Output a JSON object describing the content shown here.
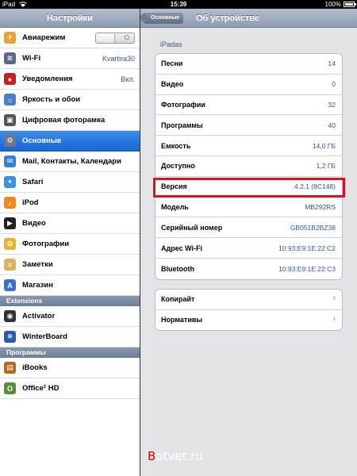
{
  "status": {
    "device": "iPad",
    "time": "15:39",
    "battery": "100%"
  },
  "sidebar": {
    "title": "Настройки",
    "items": [
      {
        "label": "Авиарежим",
        "icon": "airplane-icon",
        "toggle": "O"
      },
      {
        "label": "Wi-Fi",
        "icon": "wifi-icon",
        "value": "Kvartira30"
      },
      {
        "label": "Уведомления",
        "icon": "notifications-icon",
        "value": "Вкл."
      },
      {
        "label": "Яркость и обои",
        "icon": "brightness-icon"
      },
      {
        "label": "Цифровая фоторамка",
        "icon": "photo-frame-icon"
      },
      {
        "label": "Основные",
        "icon": "gear-icon",
        "selected": true
      },
      {
        "label": "Mail, Контакты, Календари",
        "icon": "mail-icon"
      },
      {
        "label": "Safari",
        "icon": "compass-icon"
      },
      {
        "label": "iPod",
        "icon": "ipod-icon"
      },
      {
        "label": "Видео",
        "icon": "video-icon"
      },
      {
        "label": "Фотографии",
        "icon": "photos-icon"
      },
      {
        "label": "Заметки",
        "icon": "notes-icon"
      },
      {
        "label": "Магазин",
        "icon": "store-icon"
      }
    ],
    "extensions_header": "Extensions",
    "extensions": [
      {
        "label": "Activator",
        "icon": "activator-icon"
      },
      {
        "label": "WinterBoard",
        "icon": "winterboard-icon"
      }
    ],
    "apps_header": "Программы",
    "apps": [
      {
        "label": "iBooks",
        "icon": "ibooks-icon"
      },
      {
        "label": "Office² HD",
        "icon": "office-icon"
      }
    ]
  },
  "detail": {
    "back_label": "Основные",
    "title": "Об устройстве",
    "group_title": "iPadas",
    "rows": [
      {
        "label": "Песни",
        "value": "14"
      },
      {
        "label": "Видео",
        "value": "0"
      },
      {
        "label": "Фотографии",
        "value": "32"
      },
      {
        "label": "Программы",
        "value": "40"
      },
      {
        "label": "Емкость",
        "value": "14,0 ГБ"
      },
      {
        "label": "Доступно",
        "value": "1,2 ГБ"
      },
      {
        "label": "Версия",
        "value": "4.2.1 (8C148)"
      },
      {
        "label": "Модель",
        "value": "MB292RS"
      },
      {
        "label": "Серийный номер",
        "value": "GB051B2BZ38"
      },
      {
        "label": "Адрес Wi-Fi",
        "value": "10:93:E9:1E:22:C2"
      },
      {
        "label": "Bluetooth",
        "value": "10:93:E9:1E:22:C3"
      }
    ],
    "links": [
      {
        "label": "Копирайт"
      },
      {
        "label": "Нормативы"
      }
    ]
  },
  "watermark": {
    "first": "B",
    "rest": "otvet.ru"
  },
  "colors": {
    "accent": "#1764d3",
    "highlight": "#e0101a",
    "value_text": "#38548c"
  }
}
